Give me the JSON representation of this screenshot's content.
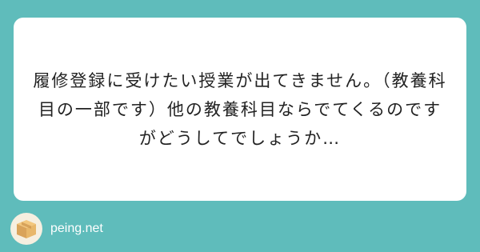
{
  "question": {
    "text": "履修登録に受けたい授業が出てきません。（教養科目の一部です）他の教養科目ならでてくるのですがどうしてでしょうか…"
  },
  "footer": {
    "site": "peing.net",
    "logo_icon": "box-icon"
  },
  "colors": {
    "background": "#5fbcbb",
    "card": "#ffffff",
    "text": "#222222"
  }
}
